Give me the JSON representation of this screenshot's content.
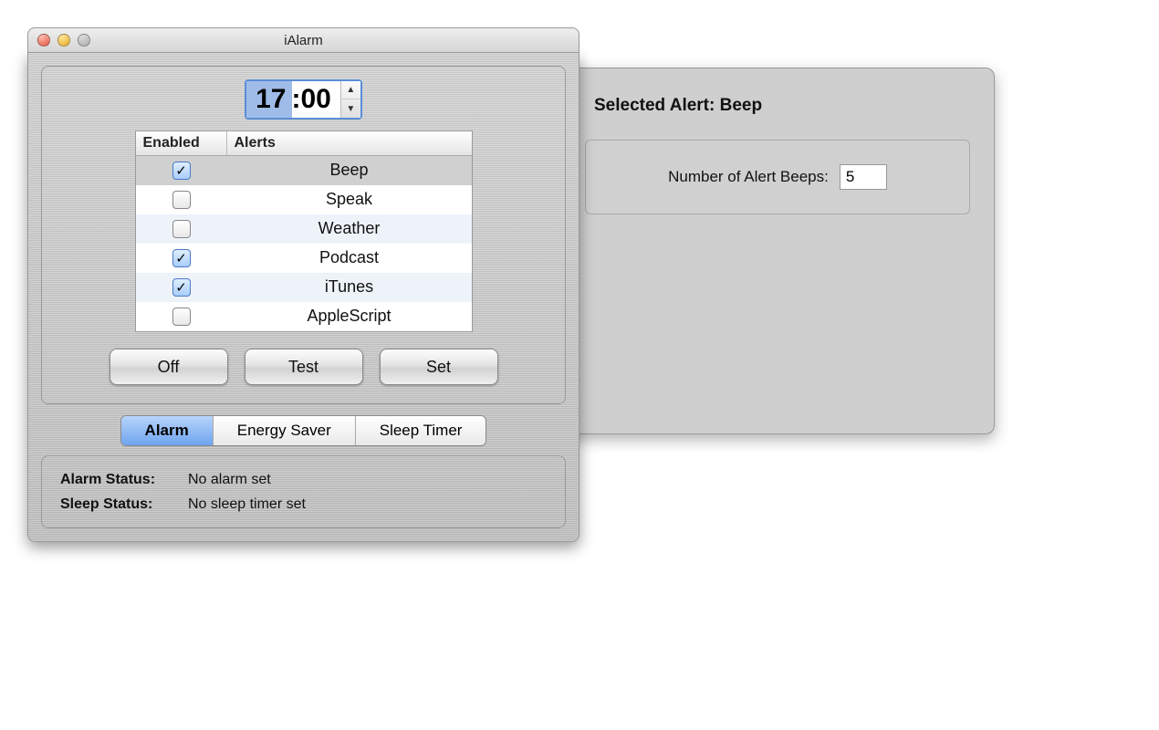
{
  "window": {
    "title": "iAlarm"
  },
  "time": {
    "hours_selected": "17",
    "rest": ":00"
  },
  "alerts_table": {
    "header_enabled": "Enabled",
    "header_alerts": "Alerts",
    "rows": [
      {
        "name": "Beep",
        "enabled": true,
        "selected": true
      },
      {
        "name": "Speak",
        "enabled": false,
        "selected": false
      },
      {
        "name": "Weather",
        "enabled": false,
        "selected": false
      },
      {
        "name": "Podcast",
        "enabled": true,
        "selected": false
      },
      {
        "name": "iTunes",
        "enabled": true,
        "selected": false
      },
      {
        "name": "AppleScript",
        "enabled": false,
        "selected": false
      }
    ]
  },
  "buttons": {
    "off": "Off",
    "test": "Test",
    "set": "Set"
  },
  "tabs": {
    "items": [
      {
        "label": "Alarm",
        "active": true
      },
      {
        "label": "Energy Saver",
        "active": false
      },
      {
        "label": "Sleep Timer",
        "active": false
      }
    ]
  },
  "status": {
    "alarm_label": "Alarm Status:",
    "alarm_value": "No alarm set",
    "sleep_label": "Sleep  Status:",
    "sleep_value": "No sleep timer set"
  },
  "drawer": {
    "title_prefix": "Selected Alert: ",
    "title_value": "Beep",
    "beeps_label": "Number of Alert Beeps:",
    "beeps_value": "5"
  }
}
